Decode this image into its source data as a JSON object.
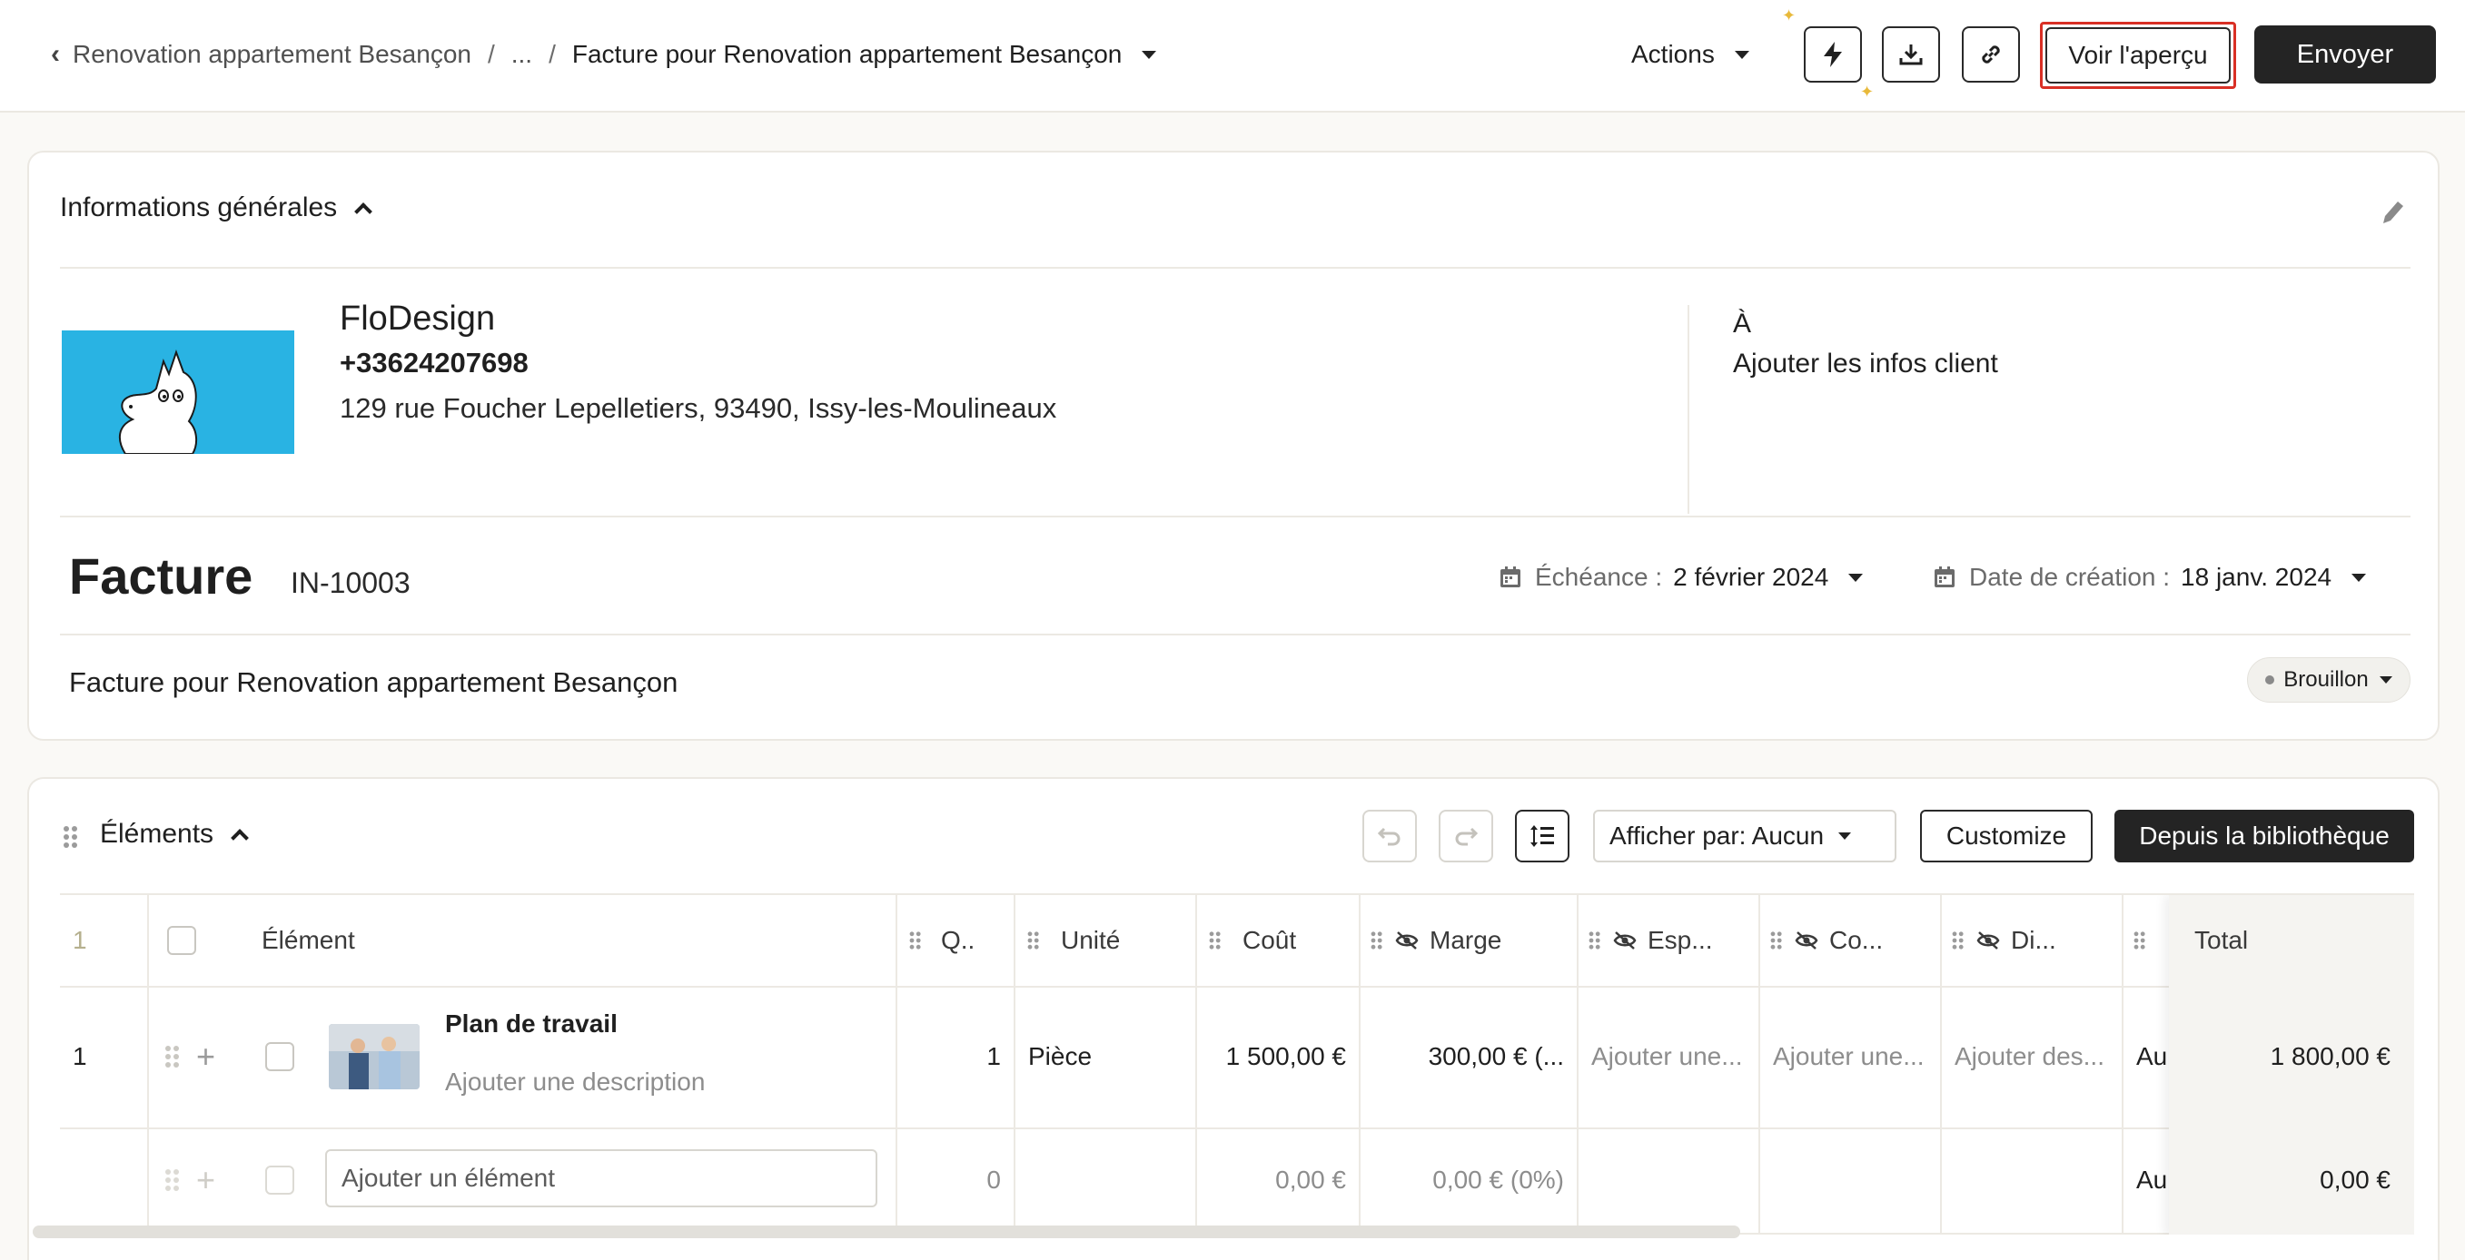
{
  "header": {
    "breadcrumb_parent": "Renovation appartement Besançon",
    "breadcrumb_ellipsis": "...",
    "breadcrumb_sep": "/",
    "breadcrumb_current": "Facture pour Renovation appartement Besançon",
    "actions_label": "Actions",
    "preview_label": "Voir l'aperçu",
    "send_label": "Envoyer",
    "icons": [
      "lightning-icon",
      "download-icon",
      "link-icon",
      "back-chevron-icon"
    ]
  },
  "general": {
    "section_title": "Informations générales",
    "company": {
      "name": "FloDesign",
      "phone": "+33624207698",
      "address": "129 rue Foucher Lepelletiers, 93490, Issy-les-Moulineaux"
    },
    "recipient_label": "À",
    "recipient_add": "Ajouter les infos client",
    "doc_type": "Facture",
    "doc_number": "IN-10003",
    "due_label": "Échéance :",
    "due_value": "2 février 2024",
    "created_label": "Date de création :",
    "created_value": "18 janv. 2024",
    "subject": "Facture pour Renovation appartement Besançon",
    "status": "Brouillon",
    "logo_color": "#29b3e3"
  },
  "elements": {
    "section_title": "Éléments",
    "group_by": "Afficher par: Aucun",
    "customize_label": "Customize",
    "library_label": "Depuis la bibliothèque",
    "columns": {
      "index": "1",
      "element": "Élément",
      "qty": "Q..",
      "unit": "Unité",
      "cost": "Coût",
      "margin": "Marge",
      "col5": "Esp...",
      "col6": "Co...",
      "col7": "Di...",
      "total": "Total"
    },
    "rows": [
      {
        "index": "1",
        "title": "Plan de travail",
        "description_placeholder": "Ajouter une description",
        "qty": "1",
        "unit": "Pièce",
        "cost": "1 500,00 €",
        "margin": "300,00 € (...",
        "col5": "Ajouter une...",
        "col6": "Ajouter une...",
        "col7": "Ajouter des...",
        "col8": "Au",
        "total": "1 800,00 €"
      }
    ],
    "add_row": {
      "placeholder": "Ajouter un élément",
      "qty": "0",
      "cost": "0,00 €",
      "margin": "0,00 € (0%)",
      "col8": "Au",
      "total": "0,00 €"
    }
  },
  "colors": {
    "accent_dark": "#242424",
    "highlight_border": "#d93025",
    "background": "#faf9f6"
  }
}
